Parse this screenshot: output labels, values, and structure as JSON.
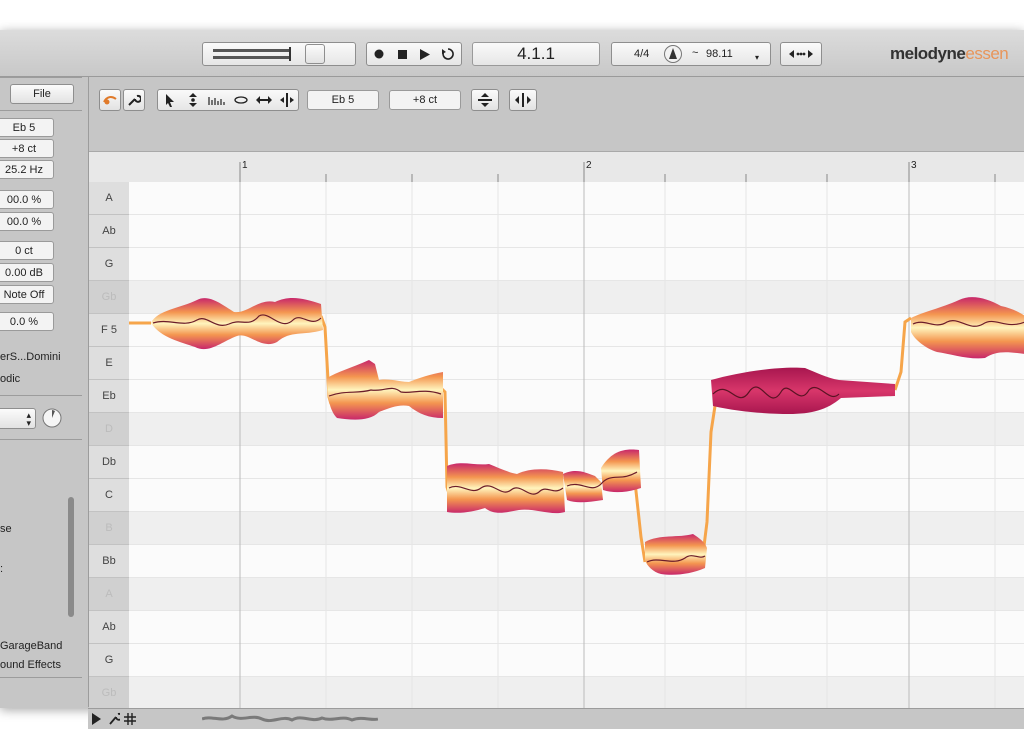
{
  "transport": {
    "position": "4.1.1",
    "time_signature": "4/4",
    "tempo_prefix": "~",
    "tempo": "98.11"
  },
  "app": {
    "brand": "melodyne",
    "edition": "essen"
  },
  "sidebar": {
    "file_label": "File",
    "pitch": "Eb 5",
    "cents": "+8 ct",
    "frequency": "25.2 Hz",
    "percent1": "00.0 %",
    "percent2": "00.0 %",
    "offset": "0 ct",
    "gain": "0.00 dB",
    "note_off": "Note Off",
    "percent3": "0.0 %",
    "instrument": "erS...Domini",
    "algorithm": "odic",
    "list_item1": "se",
    "list_item2": "GarageBand",
    "list_item3": "ound Effects"
  },
  "editor": {
    "pitch_field": "Eb 5",
    "cents_field": "+8 ct",
    "bars": [
      "1",
      "2",
      "3"
    ],
    "keys": [
      {
        "label": "A",
        "black": false
      },
      {
        "label": "Ab",
        "black": false
      },
      {
        "label": "G",
        "black": false
      },
      {
        "label": "Gb",
        "black": true
      },
      {
        "label": "F 5",
        "black": false
      },
      {
        "label": "E",
        "black": false
      },
      {
        "label": "Eb",
        "black": false
      },
      {
        "label": "D",
        "black": true
      },
      {
        "label": "Db",
        "black": false
      },
      {
        "label": "C",
        "black": false
      },
      {
        "label": "B",
        "black": true
      },
      {
        "label": "Bb",
        "black": false
      },
      {
        "label": "A",
        "black": true
      },
      {
        "label": "Ab",
        "black": false
      },
      {
        "label": "G",
        "black": false
      },
      {
        "label": "Gb",
        "black": true
      }
    ]
  },
  "colors": {
    "blob_light": "#fff2b8",
    "blob_mid": "#f6a054",
    "blob_dark": "#c21e5c",
    "pitch_line": "#f6a54a"
  }
}
